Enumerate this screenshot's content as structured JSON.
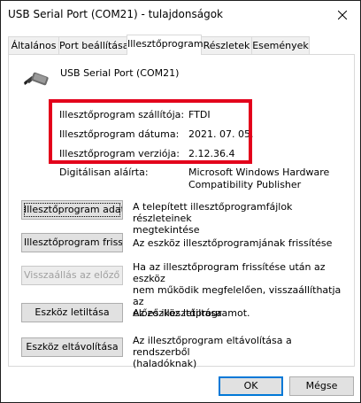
{
  "window": {
    "title": "USB Serial Port (COM21) - tulajdonságok"
  },
  "tabs": [
    {
      "label": "Általános"
    },
    {
      "label": "Port beállítása"
    },
    {
      "label": "Illesztőprogram"
    },
    {
      "label": "Részletek"
    },
    {
      "label": "Események"
    }
  ],
  "device": {
    "name": "USB Serial Port (COM21)",
    "icon": "serial-port-icon"
  },
  "properties": {
    "provider_label": "Illesztőprogram szállítója:",
    "provider_value": "FTDI",
    "date_label": "Illesztőprogram dátuma:",
    "date_value": "2021. 07. 05.",
    "version_label": "Illesztőprogram verziója:",
    "version_value": "2.12.36.4",
    "signer_label": "Digitálisan aláírta:",
    "signer_value_line1": "Microsoft Windows Hardware",
    "signer_value_line2": "Compatibility Publisher"
  },
  "actions": [
    {
      "button": "Illesztőprogram adatai",
      "desc_line1": "A telepített illesztőprogramfájlok részleteinek",
      "desc_line2": "megtekintése",
      "desc_line3": ""
    },
    {
      "button": "Illesztőprogram frissítése",
      "desc_line1": "Az eszköz illesztőprogramjának frissítése",
      "desc_line2": "",
      "desc_line3": ""
    },
    {
      "button": "Visszaállás az előző illesztőprogramra",
      "desc_line1": "Ha az illesztőprogram frissítése után az eszköz",
      "desc_line2": "nem működik megfelelően, visszaállíthatja az",
      "desc_line3": "előző illesztőprogramot."
    },
    {
      "button": "Eszköz letiltása",
      "desc_line1": "Az eszköz letiltása",
      "desc_line2": "",
      "desc_line3": ""
    },
    {
      "button": "Eszköz eltávolítása",
      "desc_line1": "Az illesztőprogram eltávolítása a rendszerből",
      "desc_line2": "(haladóknak)",
      "desc_line3": ""
    }
  ],
  "dialog": {
    "ok_label": "OK",
    "cancel_label": "Mégse"
  },
  "colors": {
    "highlight": "#e3001b",
    "default_button_border": "#0078d7"
  }
}
